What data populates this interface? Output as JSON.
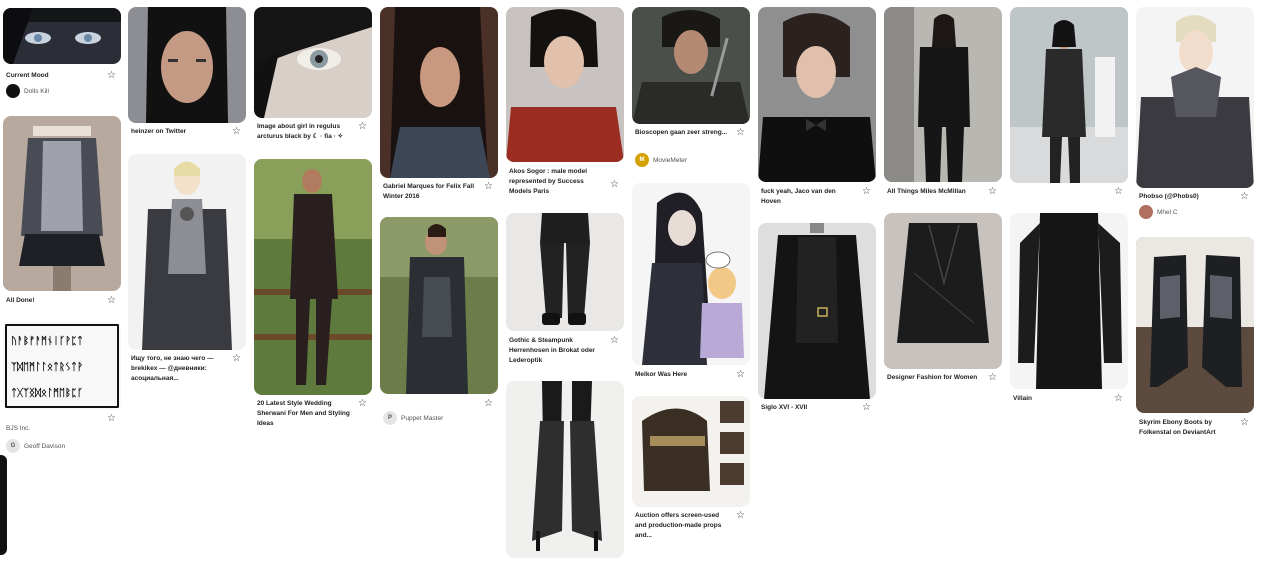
{
  "pins": {
    "c1": [
      {
        "caption": "Current Mood",
        "source": "Dolls Kill",
        "avatar": "",
        "avatar_color": "#111111"
      },
      {
        "caption": "All Done!"
      },
      {
        "caption": "",
        "source_line": "BJS Inc.",
        "source": "Geoff Davison",
        "avatar": "G",
        "avatar_color": "#e5e5e5"
      }
    ],
    "c2": [
      {
        "caption_bold": "heinzer",
        "caption": " on Twitter"
      },
      {
        "caption": "Ищу того, не знаю чего — brekikex — @дневники: асоциальная..."
      }
    ],
    "c3": [
      {
        "caption": "Image about girl in regulus arcturus black by ☾ · fia · ✧"
      },
      {
        "caption": "20 Latest Style Wedding Sherwani For Men and Styling Ideas"
      }
    ],
    "c4": [
      {
        "caption": "Gabriel Marques for Felix Fall Winter 2016"
      },
      {
        "caption": "",
        "source": "Puppet Master",
        "avatar": "P",
        "avatar_color": "#e5e5e5"
      }
    ],
    "c5": [
      {
        "caption": "Akos Sogor : male model represented by Success Models Paris"
      },
      {
        "caption": "Gothic & Steampunk Herrenhosen in Brokat oder Lederoptik"
      },
      {
        "caption": ""
      }
    ],
    "c6": [
      {
        "caption": "Bioscopen gaan zeer streng...",
        "source": "MovieMeter",
        "avatar": "M",
        "avatar_color": "#d4a100"
      },
      {
        "caption": "Melkor Was Here"
      },
      {
        "caption": "Auction offers screen-used and production-made props and..."
      }
    ],
    "c7": [
      {
        "caption": "fuck yeah, Jaco van den Hoven"
      },
      {
        "caption": "Siglo XVI - XVII"
      }
    ],
    "c8": [
      {
        "caption": "All Things Miles McMillan"
      },
      {
        "caption": "Designer Fashion for Women"
      }
    ],
    "c9": [
      {
        "caption": ""
      },
      {
        "caption": "Villain"
      }
    ],
    "c10": [
      {
        "caption": "Phobso (@Phobs0)",
        "source": "Mhel C",
        "avatar": "",
        "avatar_color": "#b07060"
      },
      {
        "caption": "Skyrim Ebony Boots by Folkenstal on DeviantArt"
      }
    ]
  },
  "star_glyph": "☆",
  "dwarf_rune_rows": [
    "ᚢᚨᛒᚠᚨᛗᚾᛁᚴᚹᛈᛏ",
    "ᛉᛞᛖᛗᛚᛚᛟᛏᚱᛊᛏᚹ",
    "ᛏᚷᛉᛝᛞᛟᛚᛗᛖᛒᛈᚴ"
  ]
}
